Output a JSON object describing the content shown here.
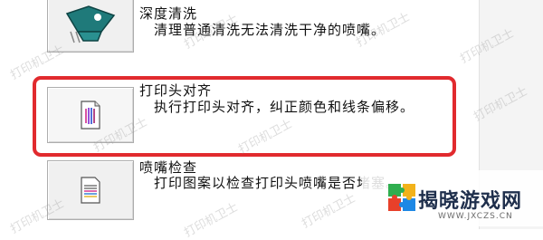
{
  "tools": [
    {
      "title": "深度清洗",
      "description": "清理普通清洗无法清洗干净的喷嘴。",
      "icon": "printhead-deep-clean-icon"
    },
    {
      "title": "打印头对齐",
      "description": "执行打印头对齐，纠正颜色和线条偏移。",
      "icon": "printhead-alignment-icon",
      "highlighted": true
    },
    {
      "title": "喷嘴检查",
      "description": "打印图案以检查打印头喷嘴是否堵塞。",
      "icon": "nozzle-check-pattern-icon"
    }
  ],
  "watermark": "打印机卫士",
  "site_badge": {
    "name": "揭晓游戏网",
    "url": "WWW.JXCZS.CN"
  },
  "colors": {
    "highlight_border": "#e12a2e",
    "icon_teal": "#1f7a7a",
    "badge_text": "#1f2f4c"
  }
}
